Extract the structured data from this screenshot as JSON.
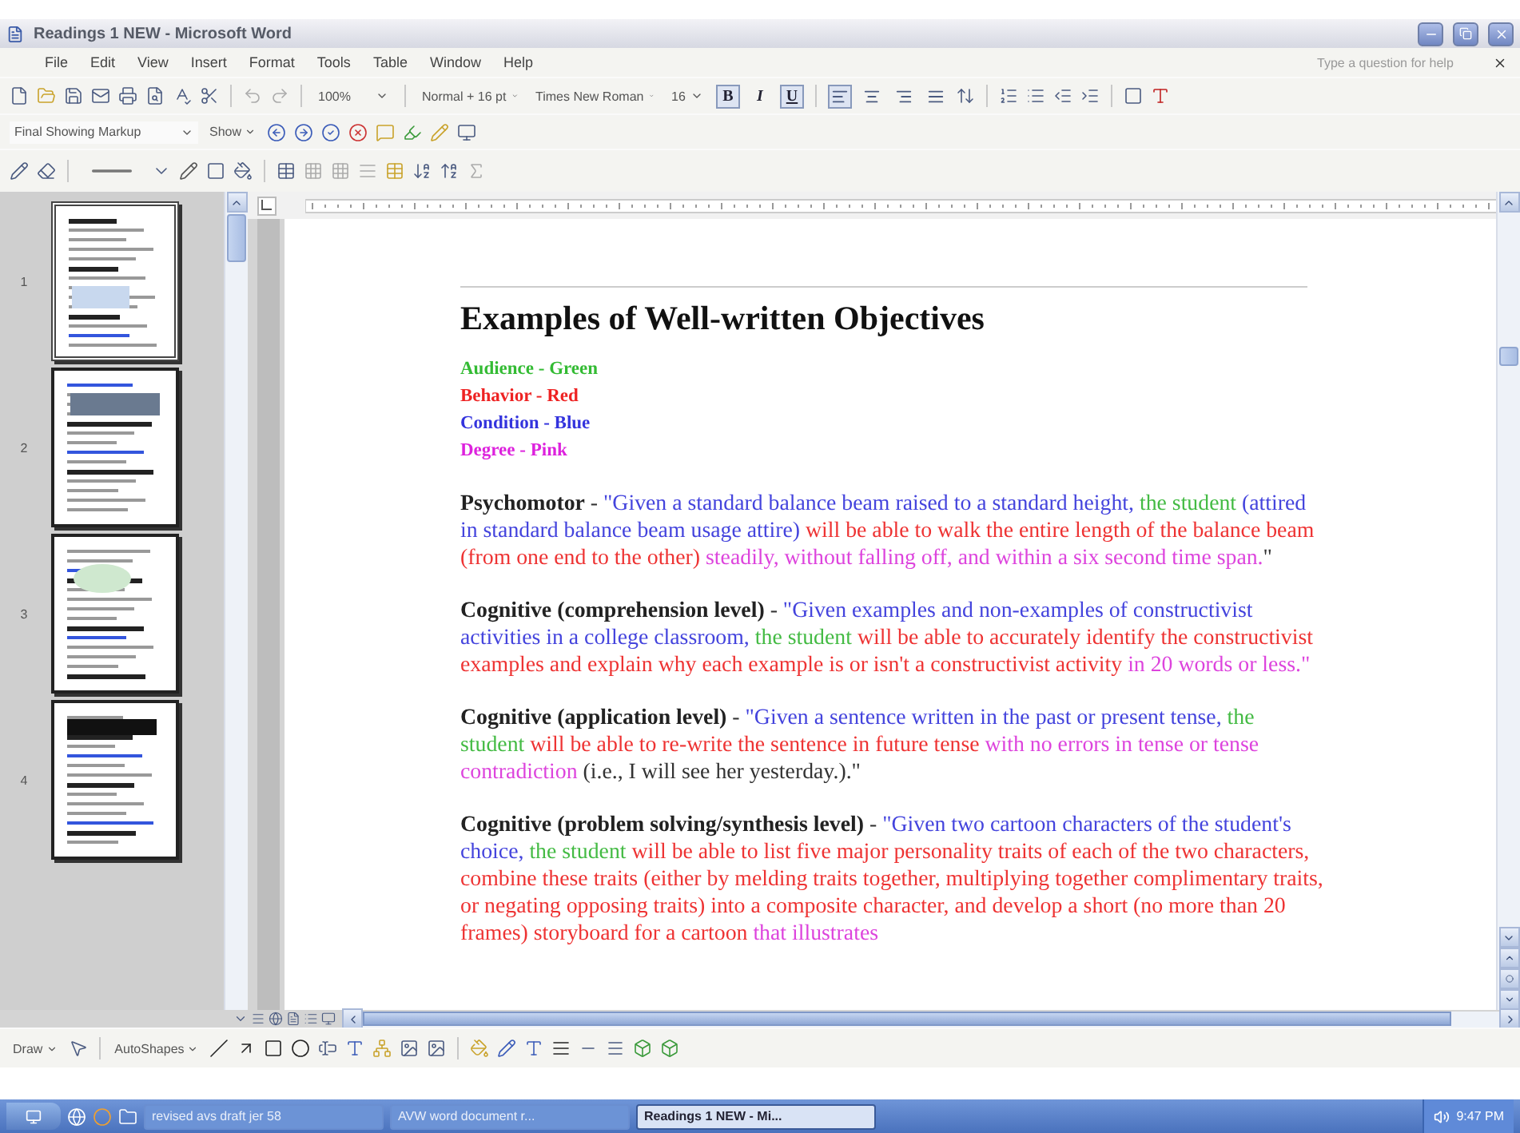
{
  "window": {
    "title": "Readings 1 NEW - Microsoft Word"
  },
  "menu": [
    "File",
    "Edit",
    "View",
    "Insert",
    "Format",
    "Tools",
    "Table",
    "Window",
    "Help"
  ],
  "help_box": {
    "placeholder": "Type a question for help"
  },
  "standard_toolbar": {
    "zoom": "100%"
  },
  "formatting_toolbar": {
    "style": "Normal + 16 pt",
    "font": "Times New Roman",
    "size": "16",
    "bold": {
      "label": "B",
      "on": true
    },
    "italic": {
      "label": "I",
      "on": false
    },
    "underline": {
      "label": "U",
      "on": true
    },
    "alignment": [
      {
        "selected": true
      },
      {
        "selected": false
      },
      {
        "selected": false
      },
      {
        "selected": false
      }
    ]
  },
  "review_toolbar": {
    "display": "Final Showing Markup",
    "show": "Show"
  },
  "thumbnails": [
    {
      "number": "1",
      "selected": true
    },
    {
      "number": "2",
      "selected": false
    },
    {
      "number": "3",
      "selected": false
    },
    {
      "number": "4",
      "selected": false
    }
  ],
  "document": {
    "heading": "Examples of Well-written Objectives",
    "legend": [
      {
        "text": "Audience - Green",
        "color": "#33bb33"
      },
      {
        "text": "Behavior - Red",
        "color": "#ee2222"
      },
      {
        "text": "Condition - Blue",
        "color": "#3333dd"
      },
      {
        "text": "Degree - Pink",
        "color": "#dd22dd"
      }
    ],
    "paragraphs": [
      {
        "label": "Psychomotor",
        "segments": [
          {
            "text": " - ",
            "color": "#333333"
          },
          {
            "text": "\"Given a standard balance beam raised to a standard height, ",
            "color": "#4444dd"
          },
          {
            "text": "the student",
            "color": "#44bb44"
          },
          {
            "text": " (attired in standard balance beam usage attire) ",
            "color": "#4444dd"
          },
          {
            "text": "will be able to walk the entire length of the balance beam (from one end to the other) ",
            "color": "#ee3333"
          },
          {
            "text": "steadily, without falling off, and within a six second time span.",
            "color": "#dd44dd"
          },
          {
            "text": "\"",
            "color": "#333333"
          }
        ]
      },
      {
        "label": "Cognitive (comprehension level)",
        "segments": [
          {
            "text": " - ",
            "color": "#333333"
          },
          {
            "text": "\"Given examples and non-examples of constructivist activities in a college classroom, ",
            "color": "#4444dd"
          },
          {
            "text": "the student",
            "color": "#44bb44"
          },
          {
            "text": " will be able to accurately identify the constructivist examples and explain why each example is or isn't a constructivist activity ",
            "color": "#ee3333"
          },
          {
            "text": "in 20 words or less.\"",
            "color": "#dd44dd"
          }
        ]
      },
      {
        "label": "Cognitive (application level)",
        "segments": [
          {
            "text": " - ",
            "color": "#333333"
          },
          {
            "text": "\"Given a sentence written in the past or present tense, ",
            "color": "#4444dd"
          },
          {
            "text": "the student",
            "color": "#44bb44"
          },
          {
            "text": " will be able to re-write the sentence in future tense ",
            "color": "#ee3333"
          },
          {
            "text": "with no errors in tense or tense contradiction",
            "color": "#dd44dd"
          },
          {
            "text": " (i.e., I will see her yesterday.).\"",
            "color": "#333333"
          }
        ]
      },
      {
        "label": "Cognitive (problem solving/synthesis level)",
        "segments": [
          {
            "text": " - ",
            "color": "#333333"
          },
          {
            "text": "\"Given two cartoon characters of the student's choice, ",
            "color": "#4444dd"
          },
          {
            "text": "the student",
            "color": "#44bb44"
          },
          {
            "text": " will be able to list five major personality traits of each of the two characters, combine these traits (either by melding traits together, multiplying together complimentary traits, or negating opposing traits) into a composite character, and develop a short (no more than 20 frames) storyboard for a cartoon ",
            "color": "#ee3333"
          },
          {
            "text": "that illustrates",
            "color": "#dd44dd"
          }
        ]
      }
    ]
  },
  "drawing_toolbar": {
    "draw": "Draw",
    "autoshapes": "AutoShapes"
  },
  "taskbar": {
    "tasks": [
      {
        "label": "revised avs draft jer 58",
        "selected": false
      },
      {
        "label": "AVW word document r...",
        "selected": false
      },
      {
        "label": "Readings 1 NEW - Mi...",
        "selected": true
      }
    ],
    "clock": "9:47 PM"
  }
}
